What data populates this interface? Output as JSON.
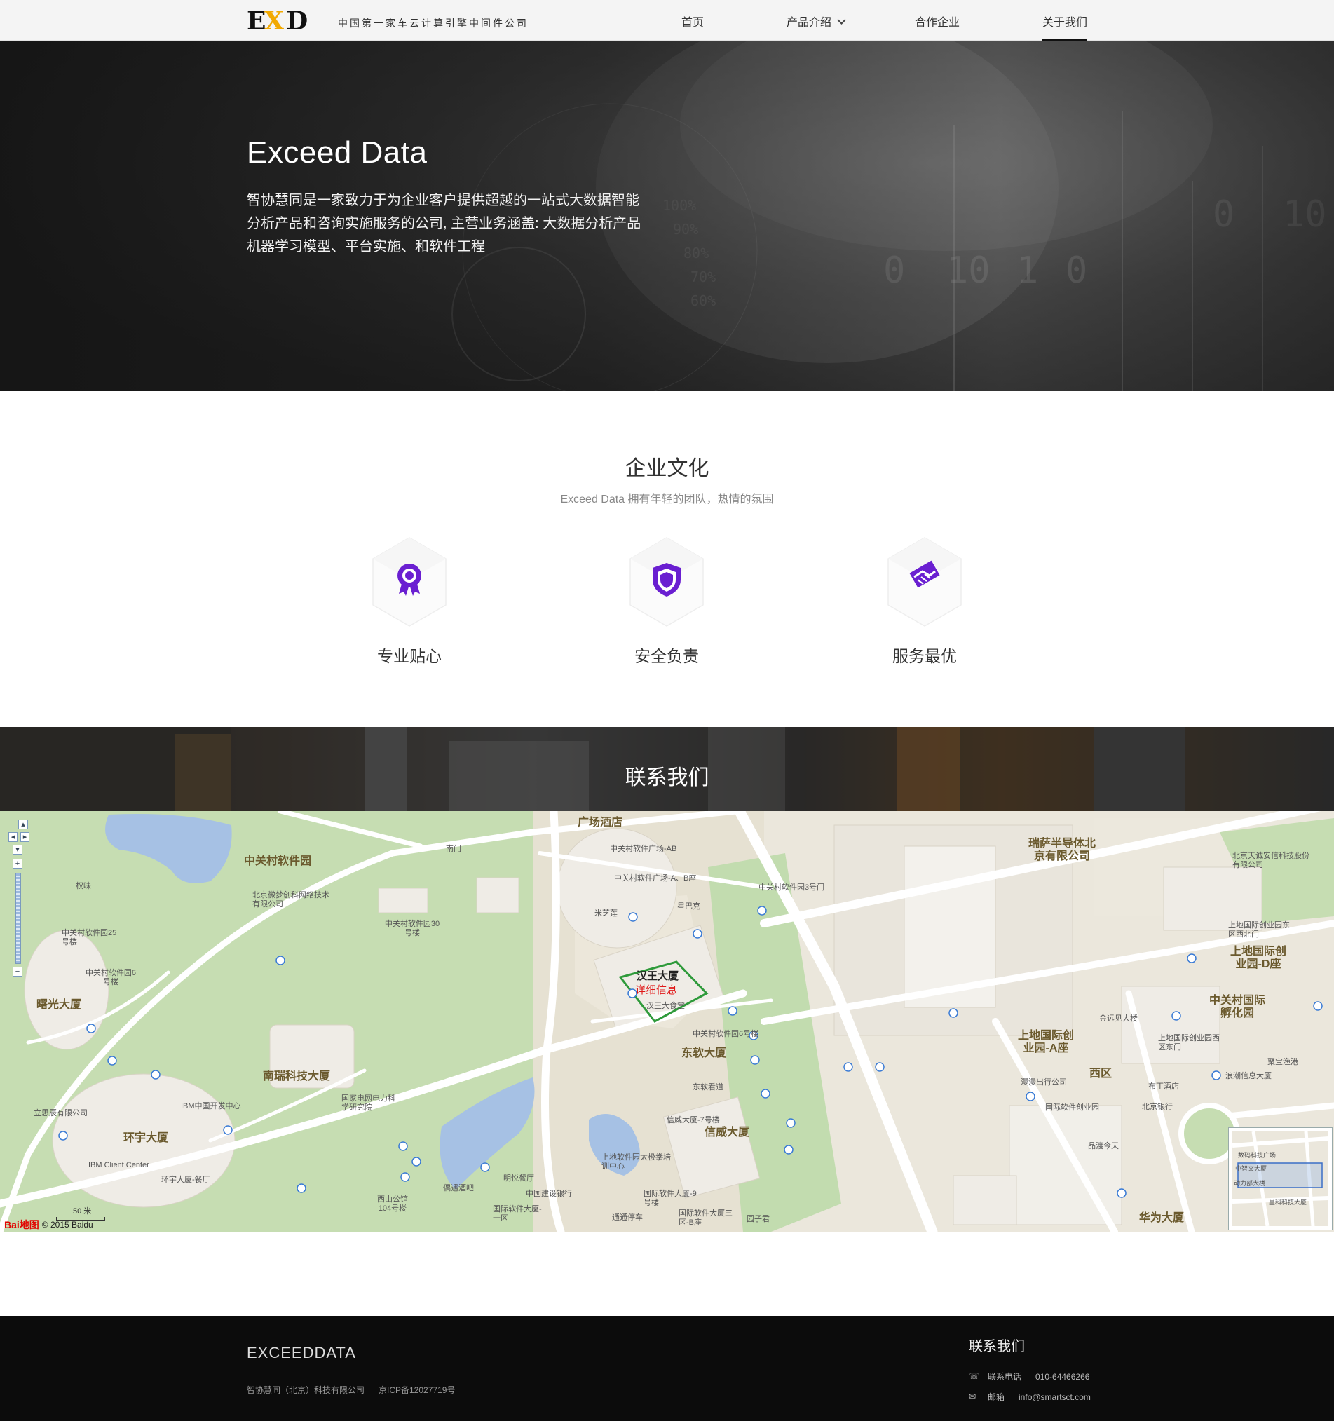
{
  "nav": {
    "logo_text": "EXD",
    "tagline": "中国第一家车云计算引擎中间件公司",
    "items": [
      {
        "label": "首页",
        "active": false
      },
      {
        "label": "产品介绍",
        "active": false,
        "dropdown": true
      },
      {
        "label": "合作企业",
        "active": false
      },
      {
        "label": "关于我们",
        "active": true
      }
    ]
  },
  "hero": {
    "title": "Exceed Data",
    "description_lines": [
      "智协慧同是一家致力于为企业客户提供超越的一站式大数据智能",
      "分析产品和咨询实施服务的公司, 主营业务涵盖: 大数据分析产品",
      "机器学习模型、平台实施、和软件工程"
    ]
  },
  "culture": {
    "title": "企业文化",
    "subtitle": "Exceed Data 拥有年轻的团队，热情的氛围",
    "features": [
      {
        "label": "专业贴心",
        "icon": "badge-icon"
      },
      {
        "label": "安全负责",
        "icon": "shield-icon"
      },
      {
        "label": "服务最优",
        "icon": "handshake-icon"
      }
    ],
    "accent_color": "#6a1fd1"
  },
  "contact": {
    "title": "联系我们"
  },
  "map": {
    "zoom_in": "+",
    "zoom_out": "−",
    "scale": "50 米",
    "copyright": "© 2015 Baidu",
    "baidu_logo": "Bai地图",
    "popup_title": "汉王大厦",
    "popup_link": "详细信息",
    "labels_big": [
      "中关村软件园",
      "曙光大厦",
      "环宇大厦",
      "南瑞科技大厦",
      "汉王大厦",
      "东软大厦",
      "信威大厦",
      "上地国际创业园-A座",
      "西区",
      "瑞萨半导体北京有限公司",
      "上地国际创业园-D座",
      "中关村国际孵化园",
      "华为大厦",
      "广场酒店"
    ],
    "labels_small": [
      "南门",
      "中关村软件广场-AB",
      "中关村软件广场-A、B座",
      "米芝莲",
      "星巴克",
      "中关村软件园3号门",
      "北京微梦创科网络技术有限公司",
      "中关村软件园30号楼",
      "中关村软件园25号楼",
      "中关村软件园6号楼",
      "权味",
      "IBM中国开发中心",
      "IBM Client Center",
      "环宇大厦-餐厅",
      "立思辰有限公司",
      "国家电网电力科学研究院",
      "金远见大楼",
      "上地国际创业园西区东门",
      "布丁酒店",
      "北京银行",
      "国际软件创业园",
      "漫漫出行公司",
      "品渡今天",
      "聚宝渔港",
      "浪潮信息大厦",
      "北京天诚安信科技股份有限公司",
      "上地国际创业园东区西北门",
      "东软看道",
      "中关村软件园6号楼",
      "信威大厦-7号楼",
      "上地软件园太极拳培训中心",
      "中国建设银行",
      "国际软件大厦-9号楼",
      "国际软件大厦三区-B座",
      "通通停车",
      "园子君",
      "国际软件大厦-一区",
      "偶遇酒吧",
      "明悦餐厅",
      "西山公馆104号楼",
      "汉王大食堂"
    ],
    "minimap_labels": [
      "数码科技广场",
      "中智文大厦",
      "动力部大楼",
      "星科科技大厦"
    ]
  },
  "footer": {
    "logo": "EXCEEDDATA",
    "company": "智协慧同（北京）科技有限公司",
    "icp": "京ICP备12027719号",
    "contact_title": "联系我们",
    "phone_label": "联系电话",
    "phone": "010-64466266",
    "email_label": "邮箱",
    "email": "info@smartsct.com"
  }
}
